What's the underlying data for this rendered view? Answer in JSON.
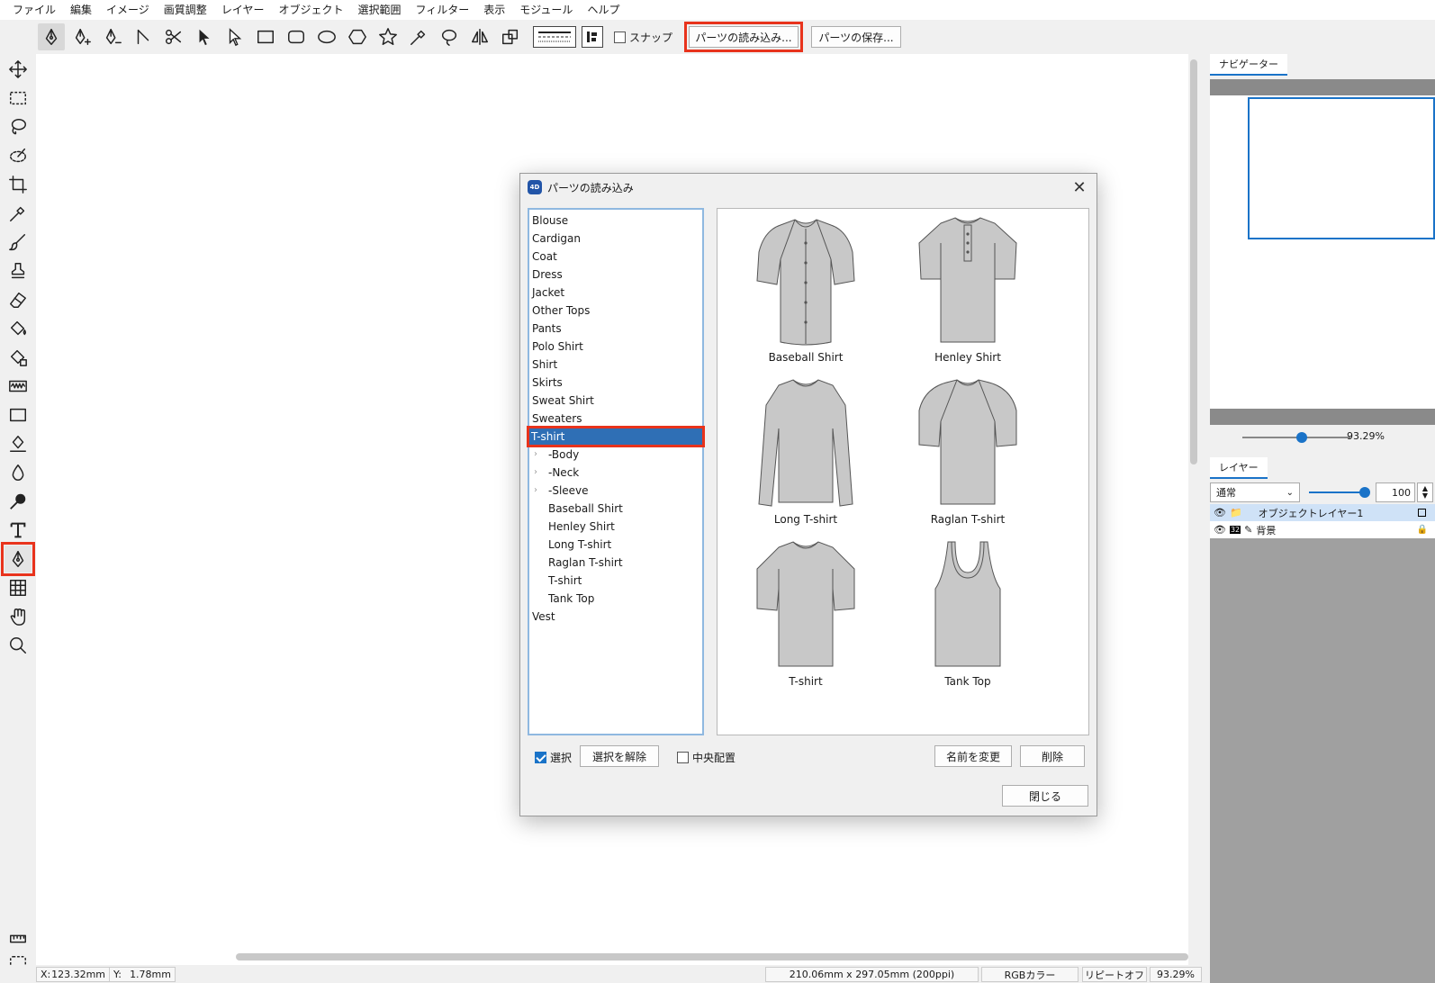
{
  "menu": [
    "ファイル",
    "編集",
    "イメージ",
    "画質調整",
    "レイヤー",
    "オブジェクト",
    "選択範囲",
    "フィルター",
    "表示",
    "モジュール",
    "ヘルプ"
  ],
  "toolbar": {
    "icons": [
      "pen-tool",
      "pen-add",
      "pen-remove",
      "corner",
      "scissors",
      "select-arrow",
      "direct-select-arrow",
      "rectangle",
      "rounded-rectangle",
      "ellipse",
      "hexagon",
      "star",
      "eyedropper",
      "lasso-bubble",
      "flip",
      "transform"
    ],
    "snap_label": "スナップ",
    "load_parts_label": "パーツの読み込み...",
    "save_parts_label": "パーツの保存..."
  },
  "left_tools": [
    "move",
    "rect-select",
    "lasso",
    "magic-select",
    "crop",
    "eyedropper",
    "brush",
    "stamp",
    "eraser",
    "fill-bucket",
    "gradient-fill",
    "wave",
    "rectangle",
    "pen-edit",
    "drop",
    "dodge",
    "text",
    "pen-tool",
    "grid",
    "hand",
    "zoom",
    "ruler",
    "circle-select"
  ],
  "status": {
    "x_label": "X:",
    "x_value": "123.32mm",
    "y_label": "Y:",
    "y_value": "1.78mm",
    "size": "210.06mm x 297.05mm (200ppi)",
    "color_mode": "RGBカラー",
    "repeat": "リピートオフ",
    "zoom": "93.29%"
  },
  "navigator": {
    "tab": "ナビゲーター",
    "zoom": "93.29%",
    "zoom_fraction": 0.55
  },
  "layers": {
    "tab": "レイヤー",
    "blend_mode": "通常",
    "opacity": "100",
    "opacity_fraction": 1.0,
    "rows": [
      {
        "name": "オブジェクトレイヤー1",
        "selected": true
      },
      {
        "name": "背景",
        "badge": "32",
        "locked": true
      }
    ]
  },
  "dialog": {
    "title": "パーツの読み込み",
    "logo": "4D",
    "categories": [
      {
        "label": "Blouse"
      },
      {
        "label": "Cardigan"
      },
      {
        "label": "Coat"
      },
      {
        "label": "Dress"
      },
      {
        "label": "Jacket"
      },
      {
        "label": "Other Tops"
      },
      {
        "label": "Pants"
      },
      {
        "label": "Polo Shirt"
      },
      {
        "label": "Shirt"
      },
      {
        "label": "Skirts"
      },
      {
        "label": "Sweat Shirt"
      },
      {
        "label": "Sweaters"
      },
      {
        "label": "T-shirt",
        "selected": true
      },
      {
        "label": "-Body",
        "sub": true,
        "expandable": true
      },
      {
        "label": "-Neck",
        "sub": true,
        "expandable": true
      },
      {
        "label": "-Sleeve",
        "sub": true,
        "expandable": true
      },
      {
        "label": "Baseball Shirt",
        "sub": true
      },
      {
        "label": "Henley Shirt",
        "sub": true
      },
      {
        "label": "Long T-shirt",
        "sub": true
      },
      {
        "label": "Raglan T-shirt",
        "sub": true
      },
      {
        "label": "T-shirt",
        "sub": true
      },
      {
        "label": "Tank Top",
        "sub": true
      },
      {
        "label": "Vest"
      }
    ],
    "items": [
      {
        "label": "Baseball Shirt",
        "shape": "baseball"
      },
      {
        "label": "Henley Shirt",
        "shape": "henley"
      },
      {
        "label": "Long T-shirt",
        "shape": "long"
      },
      {
        "label": "Raglan T-shirt",
        "shape": "raglan"
      },
      {
        "label": "T-shirt",
        "shape": "tshirt"
      },
      {
        "label": "Tank Top",
        "shape": "tank"
      }
    ],
    "select_label": "選択",
    "deselect_label": "選択を解除",
    "center_label": "中央配置",
    "rename_label": "名前を変更",
    "delete_label": "削除",
    "close_label": "閉じる"
  }
}
